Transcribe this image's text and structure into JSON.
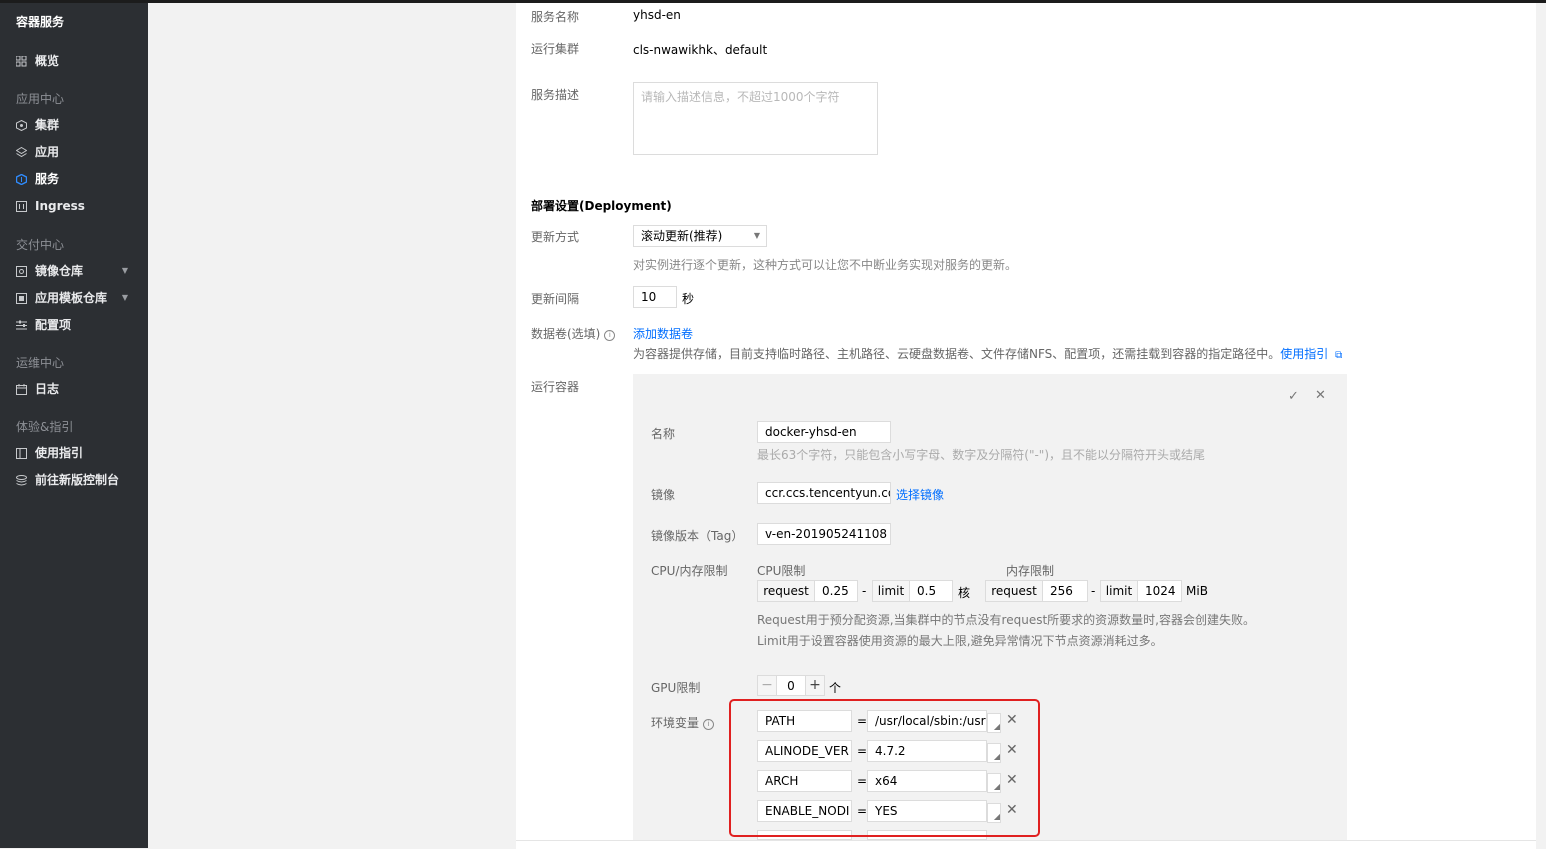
{
  "sidebar": {
    "title": "容器服务",
    "items": [
      {
        "label": "概览",
        "icon": "grid-icon"
      },
      {
        "group": "应用中心"
      },
      {
        "label": "集群",
        "icon": "cluster-icon"
      },
      {
        "label": "应用",
        "icon": "layers-icon"
      },
      {
        "label": "服务",
        "icon": "service-icon",
        "active": true
      },
      {
        "label": "Ingress",
        "icon": "ingress-icon"
      },
      {
        "group": "交付中心"
      },
      {
        "label": "镜像仓库",
        "icon": "image-repo-icon",
        "expandable": true
      },
      {
        "label": "应用模板仓库",
        "icon": "template-repo-icon",
        "expandable": true
      },
      {
        "label": "配置项",
        "icon": "config-icon"
      },
      {
        "group": "运维中心"
      },
      {
        "label": "日志",
        "icon": "calendar-icon"
      },
      {
        "group": "体验&指引"
      },
      {
        "label": "使用指引",
        "icon": "book-icon"
      },
      {
        "label": "前往新版控制台",
        "icon": "stack-icon"
      }
    ]
  },
  "form": {
    "service_name_label": "服务名称",
    "service_name": "yhsd-en",
    "cluster_label": "运行集群",
    "cluster": "cls-nwawikhk、default",
    "desc_label": "服务描述",
    "desc_placeholder": "请输入描述信息，不超过1000个字符",
    "deployment_title": "部署设置(Deployment)",
    "update_mode_label": "更新方式",
    "update_mode": "滚动更新(推荐)",
    "update_mode_hint": "对实例进行逐个更新，这种方式可以让您不中断业务实现对服务的更新。",
    "interval_label": "更新间隔",
    "interval_value": "10",
    "interval_unit": "秒",
    "volume_label": "数据卷(选填)",
    "volume_add": "添加数据卷",
    "volume_hint": "为容器提供存储，目前支持临时路径、主机路径、云硬盘数据卷、文件存储NFS、配置项，还需挂载到容器的指定路径中。",
    "volume_guide": "使用指引",
    "containers_label": "运行容器"
  },
  "container": {
    "name_label": "名称",
    "name_value": "docker-yhsd-en",
    "name_hint": "最长63个字符，只能包含小写字母、数字及分隔符(\"-\")，且不能以分隔符开头或结尾",
    "image_label": "镜像",
    "image_value": "ccr.ccs.tencentyun.com",
    "image_select": "选择镜像",
    "tag_label": "镜像版本（Tag）",
    "tag_value": "v-en-201905241108",
    "cpu_mem_label": "CPU/内存限制",
    "cpu_limit_label": "CPU限制",
    "mem_limit_label": "内存限制",
    "cpu_request_addon": "request",
    "cpu_request": "0.25",
    "cpu_limit_addon": "limit",
    "cpu_limit": "0.5",
    "cpu_unit": "核",
    "mem_request_addon": "request",
    "mem_request": "256",
    "mem_limit_addon": "limit",
    "mem_limit": "1024",
    "mem_unit": "MiB",
    "dash": "-",
    "request_hint": "Request用于预分配资源,当集群中的节点没有request所要求的资源数量时,容器会创建失败。",
    "limit_hint": "Limit用于设置容器使用资源的最大上限,避免异常情况下节点资源消耗过多。",
    "gpu_label": "GPU限制",
    "gpu_value": "0",
    "gpu_unit": "个",
    "env_label": "环境变量",
    "env": [
      {
        "key": "PATH",
        "value": "/usr/local/sbin:/usr"
      },
      {
        "key": "ALINODE_VER",
        "value": "4.7.2"
      },
      {
        "key": "ARCH",
        "value": "x64"
      },
      {
        "key": "ENABLE_NODI",
        "value": "YES"
      }
    ],
    "eq": "="
  }
}
